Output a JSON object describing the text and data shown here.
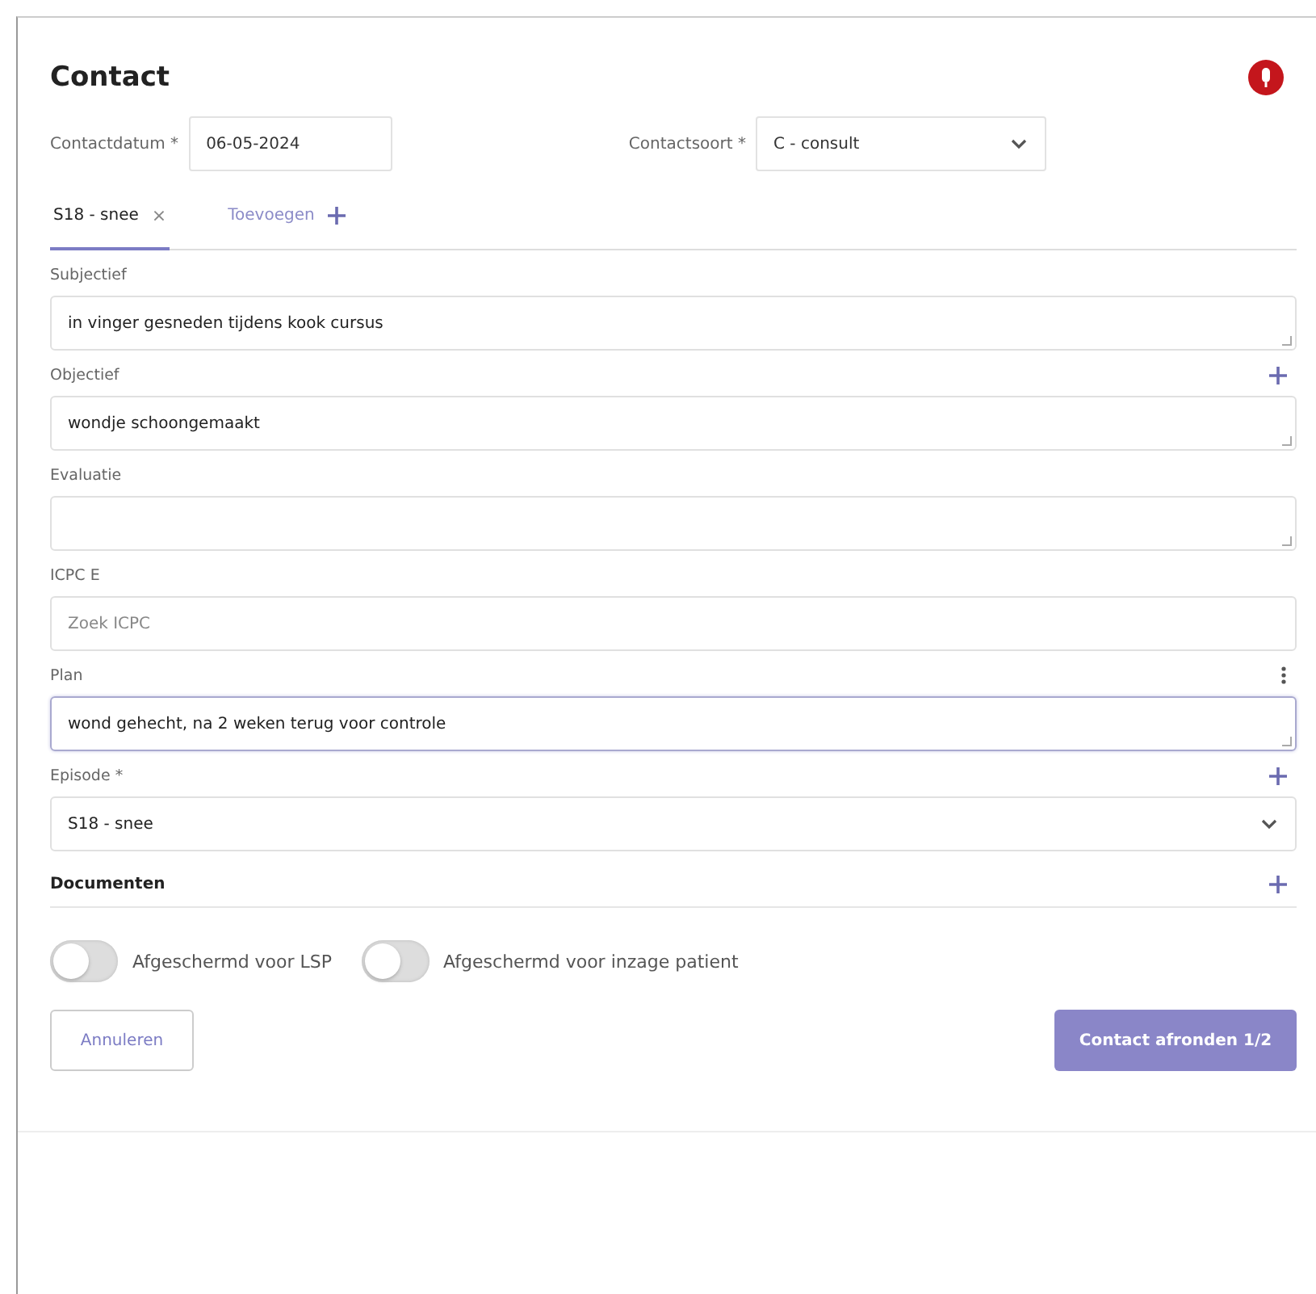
{
  "title": "Contact",
  "header_fields": [
    {
      "kind": "date",
      "label": "Contactdatum *",
      "value": "06-05-2024"
    },
    {
      "kind": "select",
      "label": "Contactsoort *",
      "value": "C - consult"
    }
  ],
  "tabs": [
    {
      "kind": "episode",
      "label": "S18 - snee",
      "close": "×",
      "selected": true
    },
    {
      "kind": "add",
      "label": "Toevoegen",
      "selected": false
    }
  ],
  "sections": [
    {
      "kind": "textarea",
      "label": "Subjectief",
      "value": "in vinger gesneden tijdens kook cursus",
      "focused": false
    },
    {
      "kind": "textarea",
      "label": "Objectief",
      "value": "wondje schoongemaakt",
      "addable": true,
      "focused": false
    },
    {
      "kind": "textarea",
      "label": "Evaluatie",
      "focused": false
    },
    {
      "kind": "search",
      "label": "ICPC E",
      "placeholder": "Zoek ICPC"
    },
    {
      "kind": "textarea",
      "label": "Plan",
      "value": "wond gehecht, na 2 weken terug voor controle",
      "menu": true,
      "focused": true
    },
    {
      "kind": "select",
      "label": "Episode *",
      "value": "S18 - snee",
      "addable": true
    },
    {
      "kind": "heading",
      "label": "Documenten",
      "addable": true
    }
  ],
  "toggles": [
    {
      "label": "Afgeschermd voor LSP",
      "on": false
    },
    {
      "label": "Afgeschermd voor inzage patient",
      "on": false
    }
  ],
  "buttons": [
    {
      "kind": "secondary",
      "label": "Annuleren"
    },
    {
      "kind": "primary",
      "label": "Contact afronden 1/2"
    }
  ]
}
